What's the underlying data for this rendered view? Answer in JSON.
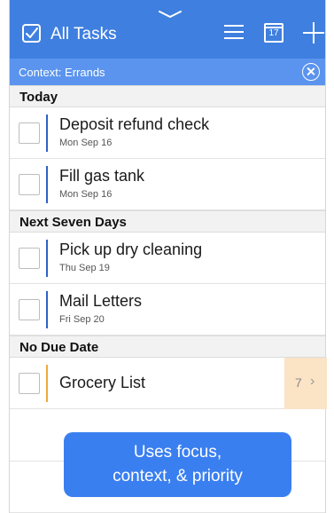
{
  "navbar": {
    "title": "All Tasks",
    "calendar_day": "17",
    "color": "#3f7fdf"
  },
  "context": {
    "label": "Context: Errands"
  },
  "sections": [
    {
      "title": "Today",
      "tasks": [
        {
          "title": "Deposit refund check",
          "date": "Mon Sep 16"
        },
        {
          "title": "Fill gas tank",
          "date": "Mon Sep 16"
        }
      ]
    },
    {
      "title": "Next Seven Days",
      "tasks": [
        {
          "title": "Pick up dry cleaning",
          "date": "Thu Sep 19"
        },
        {
          "title": "Mail Letters",
          "date": "Fri Sep 20"
        }
      ]
    },
    {
      "title": "No Due Date",
      "tasks": [
        {
          "title": "Grocery List",
          "count": "7",
          "chevron": "›"
        }
      ]
    }
  ],
  "callout": {
    "line1": "Uses focus,",
    "line2": "context, & priority"
  },
  "icons": {
    "nav_check": "checkbox-icon",
    "nav_list": "list-icon",
    "nav_calendar": "calendar-icon",
    "nav_add": "plus-icon",
    "context_clear": "clear-icon"
  },
  "colors": {
    "accent": "#3f7fdf",
    "context_bar": "#5b94ee",
    "priority_blue": "#2e62c6",
    "priority_orange": "#f2a83b",
    "count_bg": "#fbe3c6"
  }
}
